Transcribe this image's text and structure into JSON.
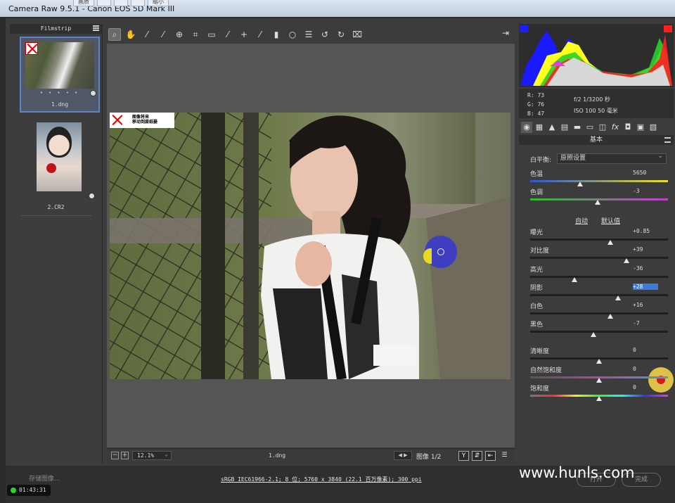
{
  "window": {
    "title": "Camera Raw 9.5.1 -  Canon EOS 5D Mark III",
    "ghost_buttons": [
      "画质",
      "",
      "",
      "",
      "缩小"
    ]
  },
  "filmstrip": {
    "header": "Filmstrip",
    "items": [
      {
        "name": "1.dng",
        "stars": "• • • • •",
        "selected": true
      },
      {
        "name": "2.CR2",
        "stars": "",
        "selected": false
      }
    ]
  },
  "toolbar": {
    "tools": [
      "zoom-icon",
      "hand-icon",
      "white-balance-icon",
      "color-sampler-icon",
      "target-adjust-icon",
      "crop-icon",
      "straighten-icon",
      "spot-removal-icon",
      "red-eye-icon",
      "adjustment-brush-icon",
      "graduated-filter-icon",
      "radial-filter-icon",
      "preferences-icon",
      "rotate-left-icon",
      "rotate-right-icon",
      "trash-icon"
    ],
    "active": "zoom-icon"
  },
  "preview": {
    "warning_line1": "图像将来",
    "warning_line2": "移动到废纸篓"
  },
  "bottombar": {
    "zoom": "12.1%",
    "filename": "1.dng",
    "image_counter": "图像 1/2",
    "y_label": "Y"
  },
  "info": {
    "r": "R:   73",
    "g": "G:   76",
    "b": "B:   47",
    "aperture_shutter": "f/2   1/3200 秒",
    "iso_focal": "ISO 100   50 毫米"
  },
  "panel": {
    "title": "基本",
    "wb_label": "白平衡:",
    "wb_value": "原照设置",
    "auto": "自动",
    "default": "默认值",
    "sliders": [
      {
        "label": "色温",
        "value": "5650",
        "pos": 0.36
      },
      {
        "label": "色调",
        "value": "-3",
        "pos": 0.49
      },
      {
        "label": "曝光",
        "value": "+0.85",
        "pos": 0.58
      },
      {
        "label": "对比度",
        "value": "+39",
        "pos": 0.7
      },
      {
        "label": "高光",
        "value": "-36",
        "pos": 0.32
      },
      {
        "label": "阴影",
        "value": "+28",
        "pos": 0.64,
        "selected": true
      },
      {
        "label": "白色",
        "value": "+16",
        "pos": 0.58
      },
      {
        "label": "黑色",
        "value": "-7",
        "pos": 0.46
      },
      {
        "label": "清晰度",
        "value": "0",
        "pos": 0.5
      },
      {
        "label": "自然饱和度",
        "value": "0",
        "pos": 0.5
      },
      {
        "label": "饱和度",
        "value": "0",
        "pos": 0.5
      }
    ]
  },
  "footer": {
    "save": "存储图像...",
    "workflow": "sRGB IEC61966-2.1; 8 位; 5760 x 3840 (22.1 百万像素); 300 ppi",
    "open": "打开",
    "done": "完成",
    "timer": "01:43:31",
    "watermark": "www.hunls.com"
  }
}
